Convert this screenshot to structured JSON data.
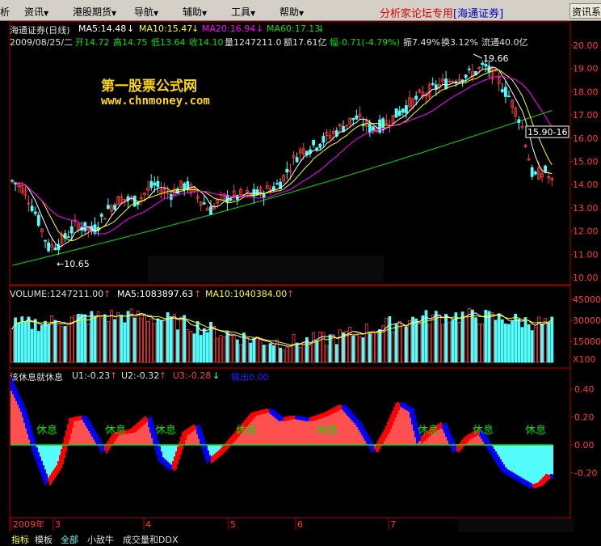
{
  "menu": {
    "left_clip": "析",
    "items": [
      "资讯",
      "港股期货",
      "导航",
      "辅助",
      "工具",
      "帮助"
    ],
    "promo": "分析家论坛专用",
    "promo_broker": "[海通证券]",
    "info_button": "资讯系"
  },
  "price_panel": {
    "title": "海通证券(日线)",
    "ma5": "MA5:14.48",
    "ma10": "MA10:15.47",
    "ma20": "MA20:16.94",
    "ma60": "MA60:17.13",
    "date": "2009/08/25/二",
    "open": "开14.72",
    "high": "高14.75",
    "low": "低13.64",
    "close": "收14.10",
    "volume": "量1247211.0",
    "amount": "额17.61亿",
    "change": "幅-0.71(-4.79%)",
    "amplitude": "振7.49%",
    "turnover": "换3.12%",
    "float": "流通40.0亿",
    "high_mark": "19.66",
    "low_mark": "←10.65",
    "current_mark": "15.90-16",
    "y_ticks": [
      "20.00",
      "19.00",
      "18.00",
      "17.00",
      "16.00",
      "15.00",
      "14.00",
      "13.00",
      "12.00",
      "11.00",
      "10.00"
    ],
    "colors": {
      "up": "#ff3c3c",
      "down": "#54fcfc",
      "ma5": "#ffffff",
      "ma10": "#ffff00",
      "ma20": "#ff00ff",
      "ma60": "#00e000"
    }
  },
  "watermark": {
    "line1": "第一股票公式网",
    "line2": "www.chnmoney.com"
  },
  "volume_panel": {
    "volume": "VOLUME:1247211.00",
    "ma5": "MA5:1083897.63",
    "ma10": "MA10:1040384.00",
    "y_ticks": [
      "45000",
      "30000",
      "15000",
      "X100"
    ]
  },
  "indicator_panel": {
    "title": "该休息就休息",
    "u1": "U1:-0.23",
    "u2": "U2:-0.32",
    "u3": "U3:-0.28",
    "out": "输出0.00",
    "y_ticks": [
      "0.40",
      "0.20",
      "0.00",
      "-0.20"
    ],
    "rest_label": "休息",
    "rest_count": 7
  },
  "time_axis": {
    "labels": [
      "2009年",
      "3",
      "4",
      "5",
      "6",
      "7"
    ]
  },
  "tabs": [
    "指标",
    "模板",
    "全部",
    "小敌牛",
    "成交量和DDX"
  ],
  "chart_data": [
    {
      "type": "line",
      "title": "海通证券(日线)",
      "x": [
        "2009年",
        "3",
        "4",
        "5",
        "6",
        "7"
      ],
      "series": [
        {
          "name": "MA5",
          "values": [
            12.6,
            11.6,
            12.4,
            13.6,
            13.4,
            14.6,
            16.5,
            18.2,
            19.0,
            14.48
          ]
        },
        {
          "name": "MA10",
          "values": [
            12.8,
            11.9,
            12.2,
            13.4,
            13.5,
            14.4,
            16.2,
            17.8,
            18.9,
            15.47
          ]
        },
        {
          "name": "MA20",
          "values": [
            13.2,
            12.4,
            12.0,
            13.2,
            13.4,
            14.2,
            15.9,
            17.4,
            18.5,
            16.94
          ]
        },
        {
          "name": "MA60",
          "values": [
            10.5,
            10.9,
            11.5,
            12.3,
            12.9,
            13.5,
            14.4,
            15.3,
            16.4,
            17.13
          ]
        }
      ],
      "ylim": [
        10,
        20
      ],
      "high": 19.66,
      "low": 10.65
    },
    {
      "type": "bar",
      "title": "VOLUME",
      "values": [
        18000,
        25000,
        30000,
        22000,
        35000,
        27000,
        20000,
        30000,
        24000,
        12000
      ],
      "ylim": [
        0,
        50000
      ]
    },
    {
      "type": "area",
      "title": "该休息就休息",
      "values": [
        0.4,
        -0.3,
        0.2,
        -0.15,
        0.2,
        -0.15,
        0.2,
        0.25,
        -0.1,
        0.25,
        -0.1,
        0.2,
        -0.3,
        -0.23
      ],
      "ylim": [
        -0.35,
        0.45
      ]
    }
  ]
}
